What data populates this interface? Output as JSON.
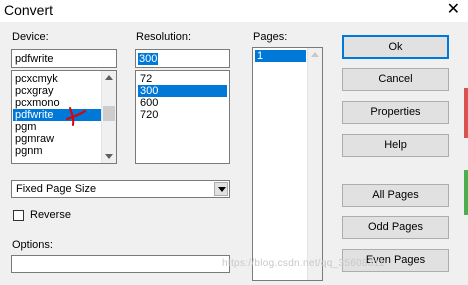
{
  "window": {
    "title": "Convert",
    "close_glyph": "✕"
  },
  "device": {
    "label": "Device:",
    "value": "pdfwrite",
    "items": [
      "pcxcmyk",
      "pcxgray",
      "pcxmono",
      "pdfwrite",
      "pgm",
      "pgmraw",
      "pgnm"
    ],
    "selected": "pdfwrite"
  },
  "resolution": {
    "label": "Resolution:",
    "value": "300",
    "items": [
      "72",
      "300",
      "600",
      "720"
    ],
    "selected": "300"
  },
  "pages": {
    "label": "Pages:",
    "items": [
      "1"
    ],
    "selected": "1"
  },
  "page_size": {
    "value": "Fixed Page Size"
  },
  "reverse": {
    "label": "Reverse",
    "checked": false
  },
  "options": {
    "label": "Options:",
    "value": ""
  },
  "buttons": {
    "ok": "Ok",
    "cancel": "Cancel",
    "properties": "Properties",
    "help": "Help",
    "all_pages": "All Pages",
    "odd_pages": "Odd Pages",
    "even_pages": "Even Pages"
  },
  "watermark": "https://blog.csdn.net/qq_35608311",
  "colors": {
    "selection": "#0078d7",
    "annotation_red": "#e00000"
  }
}
